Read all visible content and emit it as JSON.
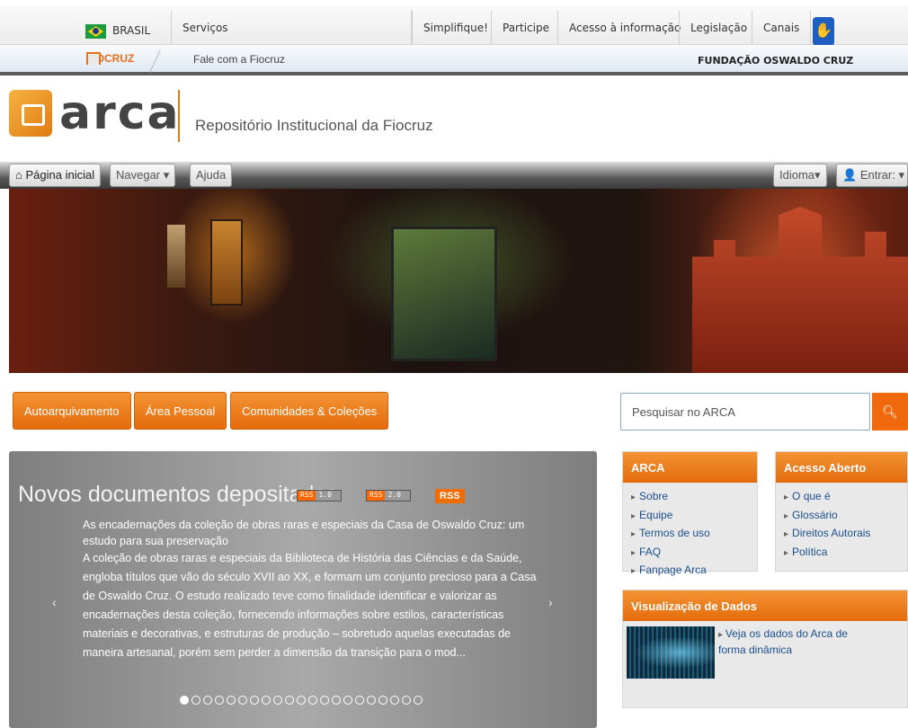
{
  "govbar": {
    "country": "BRASIL",
    "services": "Serviços",
    "links": [
      "Simplifique!",
      "Participe",
      "Acesso à informação",
      "Legislação",
      "Canais"
    ]
  },
  "fiobar": {
    "logo": "FIOCRUZ",
    "contact": "Fale com a Fiocruz",
    "foundation": "FUNDAÇÃO OSWALDO CRUZ"
  },
  "header": {
    "logo_text": "arca",
    "subtitle": "Repositório Institucional da Fiocruz"
  },
  "nav": {
    "home": "Página inicial",
    "browse": "Navegar",
    "help": "Ajuda",
    "language": "Idioma",
    "login": "Entrar:"
  },
  "actions": {
    "self_archive": "Autoarquivamento",
    "personal_area": "Área Pessoal",
    "communities": "Comunidades & Coleções"
  },
  "search": {
    "placeholder": "Pesquisar no ARCA"
  },
  "carousel": {
    "title_prefix": "Novos ",
    "title_main": "documentos depositados",
    "rss_feeds": [
      {
        "tag": "RSS",
        "version": "1.0"
      },
      {
        "tag": "RSS",
        "version": "2.0"
      }
    ],
    "rss_button": "RSS",
    "headline": "As encadernações da coleção de obras raras e especiais da Casa de Oswaldo Cruz: um estudo para sua preservação",
    "body": "A coleção de obras raras e especiais da Biblioteca de História das Ciências e da Saúde, engloba títulos que vão do século XVII ao XX, e formam um conjunto precioso para a Casa de Oswaldo Cruz. O estudo realizado teve como finalidade identificar e valorizar as encadernações desta coleção, fornecendo informações sobre estilos, características materiais e decorativas, e estruturas de produção – sobretudo aquelas executadas de maneira artesanal, porém sem perder a dimensão da transição para o mod...",
    "prev": "‹",
    "next": "›",
    "slide_count": 21,
    "active_slide": 1
  },
  "sidebar": {
    "arca": {
      "title": "ARCA",
      "items": [
        "Sobre",
        "Equipe",
        "Termos de uso",
        "FAQ",
        "Fanpage Arca"
      ]
    },
    "open_access": {
      "title": "Acesso Aberto",
      "items": [
        "O que é",
        "Glossário",
        "Direitos Autorais",
        "Política"
      ]
    },
    "data_viz": {
      "title": "Visualização de Dados",
      "link": "Veja os dados do Arca de forma dinâmica"
    }
  },
  "colors": {
    "accent": "#e46c0c",
    "link": "#1b4f8b",
    "nav_dark": "#3a3a3a"
  }
}
